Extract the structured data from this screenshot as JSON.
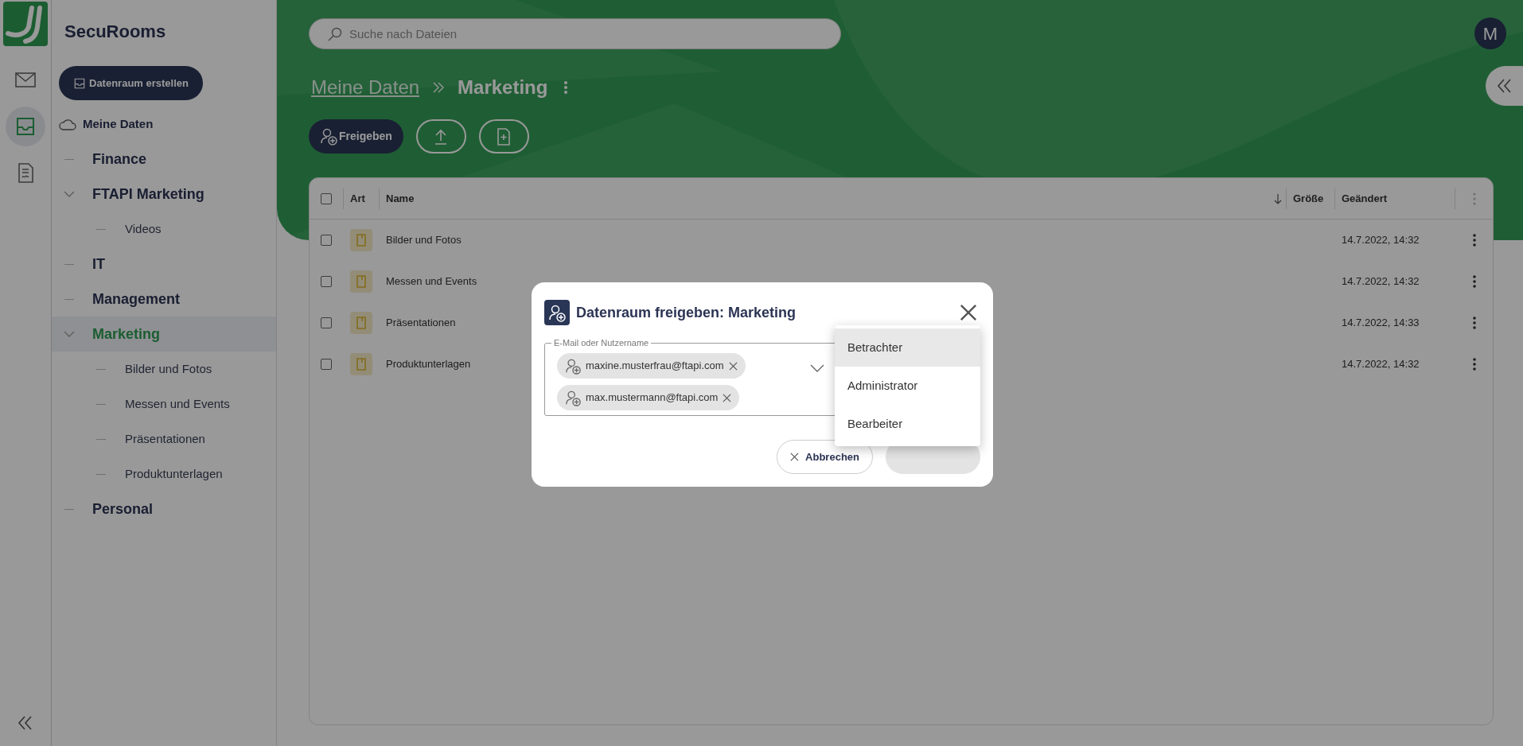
{
  "rail": {
    "items": [
      {
        "kind": "mail",
        "selected": false
      },
      {
        "kind": "inbox",
        "selected": true
      },
      {
        "kind": "document",
        "selected": false
      }
    ]
  },
  "sidebar": {
    "title": "SecuRooms",
    "create_button": "Datenraum erstellen",
    "root": "Meine Daten",
    "tree": [
      {
        "label": "Finance",
        "expanded": false,
        "selected": false
      },
      {
        "label": "FTAPI Marketing",
        "expanded": true,
        "selected": false,
        "children": [
          {
            "label": "Videos",
            "selected": false
          }
        ]
      },
      {
        "label": "IT",
        "expanded": false,
        "selected": false
      },
      {
        "label": "Management",
        "expanded": false,
        "selected": false
      },
      {
        "label": "Marketing",
        "expanded": true,
        "selected": true,
        "children": [
          {
            "label": "Bilder und Fotos",
            "selected": false
          },
          {
            "label": "Messen und Events",
            "selected": false
          },
          {
            "label": "Präsentationen",
            "selected": false
          },
          {
            "label": "Produktunterlagen",
            "selected": false
          }
        ]
      },
      {
        "label": "Personal",
        "expanded": false,
        "selected": false
      }
    ]
  },
  "search": {
    "placeholder": "Suche nach Dateien"
  },
  "avatar": "M",
  "breadcrumb": [
    "Meine Daten",
    "Marketing"
  ],
  "toolbar": {
    "share_button": "Freigeben",
    "icon_buttons": [
      {
        "kind": "upload"
      },
      {
        "kind": "new-file"
      }
    ]
  },
  "table": {
    "all_checked": false,
    "columns": [
      {
        "label": "Art",
        "sort_descending": false
      },
      {
        "label": "Name",
        "sort_descending": true
      },
      {
        "label": "Größe",
        "sort_descending": false
      },
      {
        "label": "Geändert",
        "sort_descending": false
      }
    ],
    "rows": [
      {
        "kind": "folder",
        "name": "Bilder und Fotos",
        "modified": "14.7.2022, 14:32",
        "checked": false
      },
      {
        "kind": "folder",
        "name": "Messen und Events",
        "modified": "14.7.2022, 14:32",
        "checked": false
      },
      {
        "kind": "folder",
        "name": "Präsentationen",
        "modified": "14.7.2022, 14:33",
        "checked": false
      },
      {
        "kind": "folder",
        "name": "Produktunterlagen",
        "modified": "14.7.2022, 14:32",
        "checked": false
      }
    ]
  },
  "dialog": {
    "title": "Datenraum freigeben: Marketing",
    "field_label": "E-Mail oder Nutzername",
    "recipients": [
      "maxine.musterfrau@ftapi.com",
      "max.mustermann@ftapi.com"
    ],
    "buttons": [
      {
        "kind": "cancel",
        "label": "Abbrechen"
      },
      {
        "kind": "confirm",
        "disabled": true
      }
    ],
    "role_menu": [
      {
        "label": "Betrachter",
        "hovered": true
      },
      {
        "label": "Administrator",
        "hovered": false
      },
      {
        "label": "Bearbeiter",
        "hovered": false
      }
    ]
  }
}
